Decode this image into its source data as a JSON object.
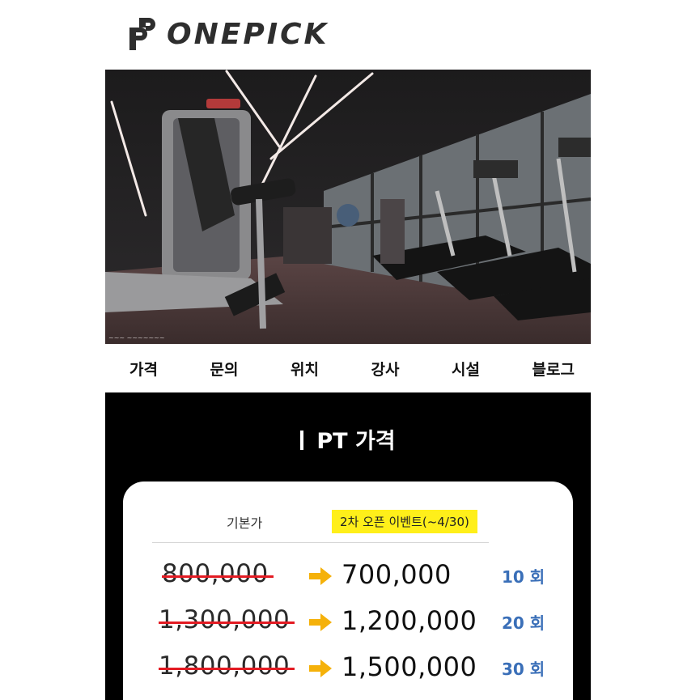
{
  "brand": {
    "name": "ONEPICK",
    "logo_icon": "onepick-mark-icon",
    "color": "#2e2e2e"
  },
  "hero": {
    "image": "gym-interior-photo",
    "watermark_icon": "photo-watermark-icon"
  },
  "nav": {
    "items": [
      "가격",
      "문의",
      "위치",
      "강사",
      "시설",
      "블로그"
    ]
  },
  "pricing": {
    "title": "PT 가격",
    "header_base": "기본가",
    "header_event": "2차 오픈 이벤트(~4/30)",
    "rows": [
      {
        "old": "800,000",
        "new": "700,000",
        "count": "10 회"
      },
      {
        "old": "1,300,000",
        "new": "1,200,000",
        "count": "20 회"
      },
      {
        "old": "1,800,000",
        "new": "1,500,000",
        "count": "30 회"
      }
    ],
    "colors": {
      "strike": "#e31b23",
      "arrow": "#f5b10a",
      "count": "#3a6fb8",
      "event_bg": "#ffef1a"
    }
  }
}
